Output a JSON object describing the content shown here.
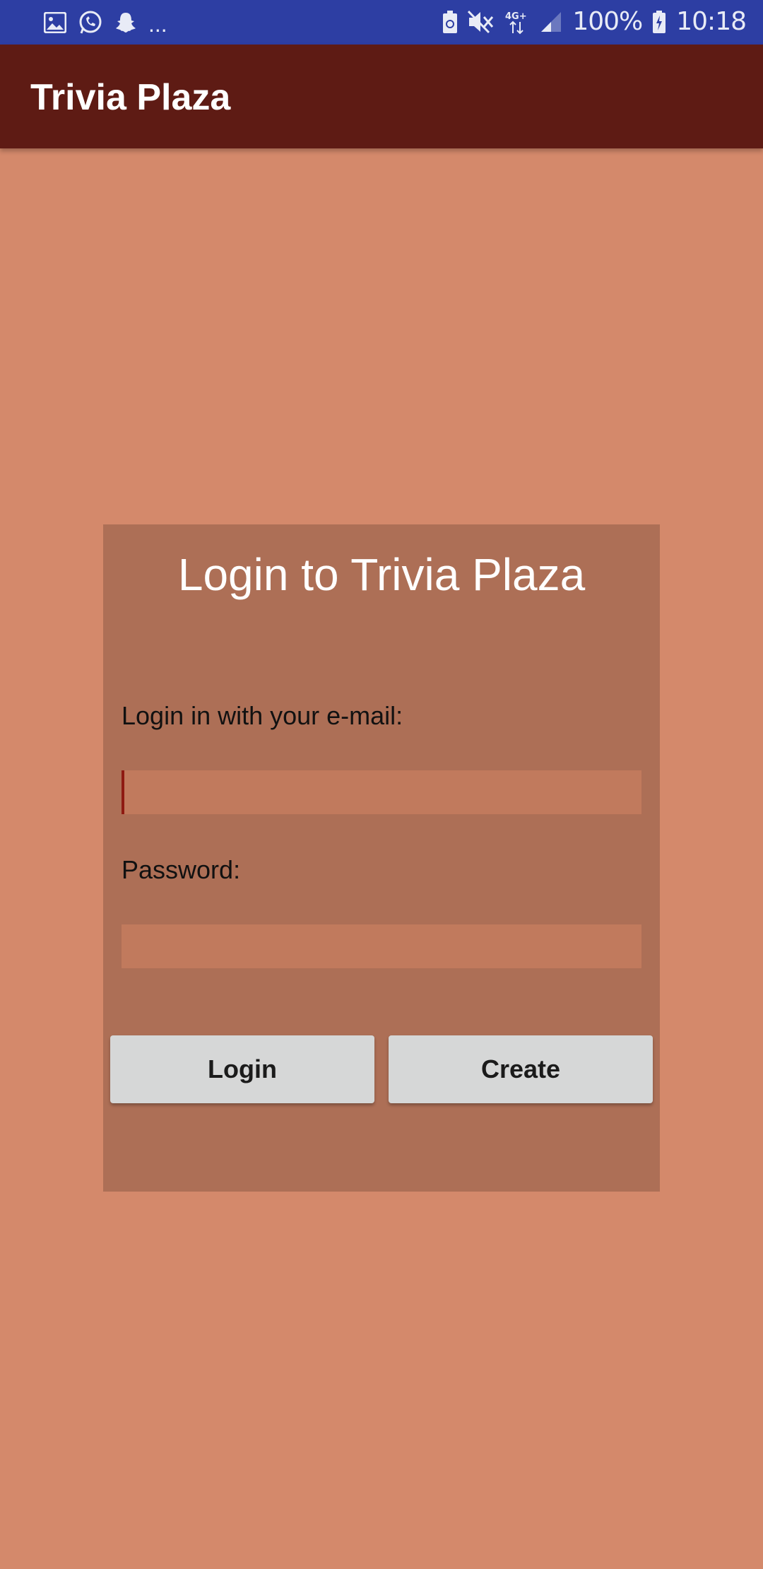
{
  "status_bar": {
    "left_icons": [
      "image-icon",
      "whatsapp-icon",
      "snapchat-icon"
    ],
    "more": "...",
    "network": "4G+",
    "battery_percent": "100%",
    "time": "10:18",
    "background": "#2d3ea3"
  },
  "app_bar": {
    "title": "Trivia Plaza",
    "background": "#5e1b14"
  },
  "login_card": {
    "title": "Login to Trivia Plaza",
    "email_label": "Login in with your e-mail:",
    "email_value": "",
    "password_label": "Password:",
    "password_value": "",
    "login_button": "Login",
    "create_button": "Create",
    "background": "#ad6f56"
  },
  "colors": {
    "page_background": "#d4896b",
    "input_background": "#c17a5d",
    "button_background": "#d6d7d7",
    "cursor_accent": "#8f1a12"
  }
}
